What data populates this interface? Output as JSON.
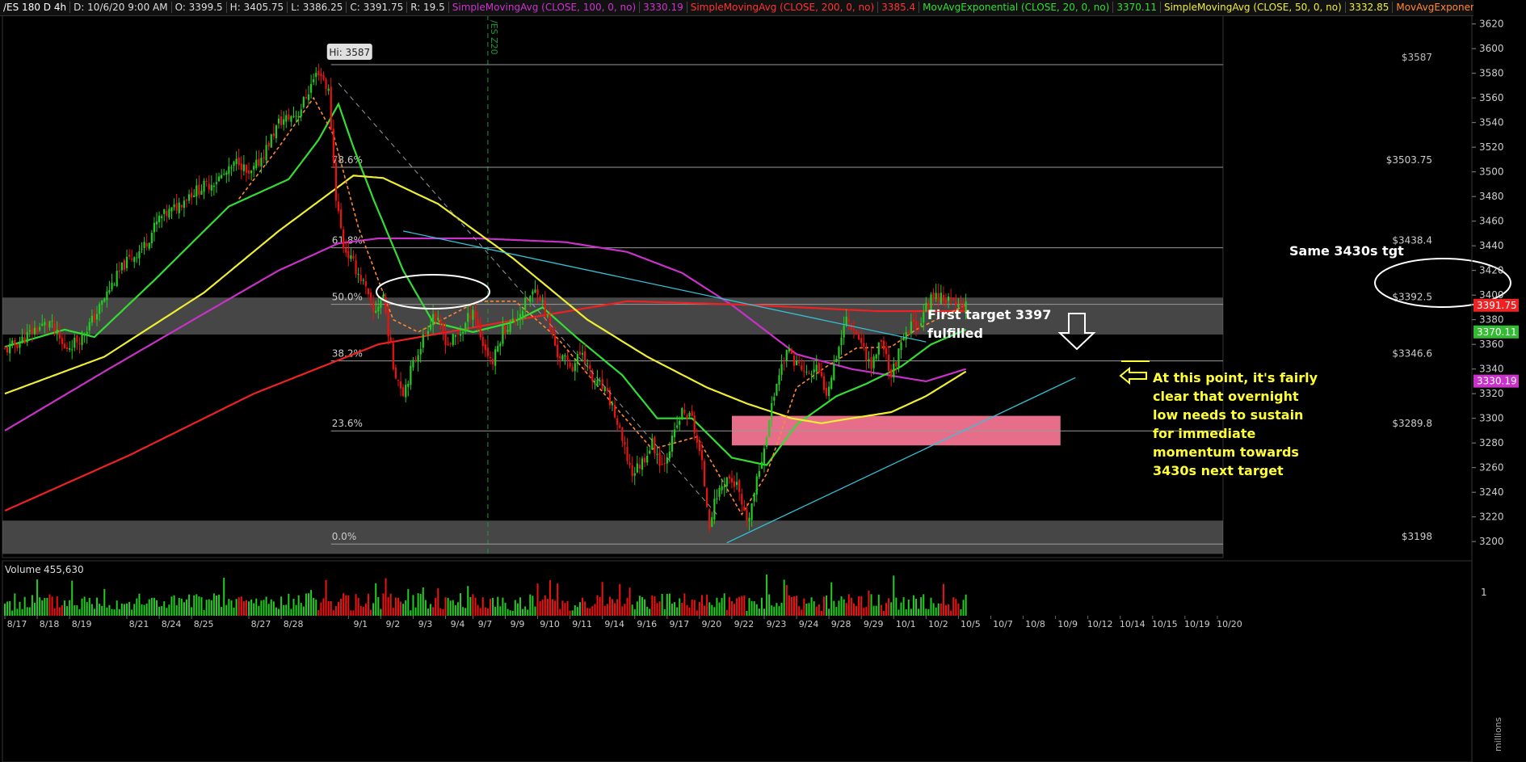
{
  "header": {
    "symbol": "/ES 180 D 4h",
    "items": [
      {
        "text": "D: 10/6/20 9:00 AM",
        "color": "#dddddd"
      },
      {
        "text": "O: 3399.5",
        "color": "#dddddd"
      },
      {
        "text": "H: 3405.75",
        "color": "#dddddd"
      },
      {
        "text": "L: 3386.25",
        "color": "#dddddd"
      },
      {
        "text": "C: 3391.75",
        "color": "#dddddd"
      },
      {
        "text": "R: 19.5",
        "color": "#dddddd"
      },
      {
        "text": "SimpleMovingAvg (CLOSE, 100, 0, no)",
        "color": "#cc33cc"
      },
      {
        "text": "3330.19",
        "color": "#cc33cc"
      },
      {
        "text": "SimpleMovingAvg (CLOSE, 200, 0, no)",
        "color": "#ff3333"
      },
      {
        "text": "3385.4",
        "color": "#ff3333"
      },
      {
        "text": "MovAvgExponential (CLOSE, 20, 0, no)",
        "color": "#33dd33"
      },
      {
        "text": "3370.11",
        "color": "#33dd33"
      },
      {
        "text": "SimpleMovingAvg (CLOSE, 50, 0, no)",
        "color": "#eeee33"
      },
      {
        "text": "3332.85",
        "color": "#eeee33"
      },
      {
        "text": "MovAvgExponential ...",
        "color": "#ff8833"
      }
    ]
  },
  "colors": {
    "up": "#22cc22",
    "down": "#ee1111",
    "sma100": "#c832c8",
    "sma200": "#ee2222",
    "ema20": "#33dd33",
    "sma50": "#eeee33",
    "ema9": "#ff8833",
    "trendline": "#33c3d8",
    "zone": "#808080",
    "pinkzone": "#ff7a9a",
    "annotation_yellow": "#ffff33",
    "annotation_white": "#ffffff"
  },
  "chart_data": {
    "type": "candlestick",
    "ylim": [
      3187,
      3627
    ],
    "yticks": [
      3200,
      3220,
      3240,
      3260,
      3280,
      3300,
      3320,
      3340,
      3360,
      3380,
      3400,
      3420,
      3440,
      3460,
      3480,
      3500,
      3520,
      3540,
      3560,
      3580,
      3600,
      3620
    ],
    "x_dates": [
      "8/17",
      "8/18",
      "8/19",
      "8/21",
      "8/24",
      "8/25",
      "8/27",
      "8/28",
      "9/1",
      "9/2",
      "9/3",
      "9/4",
      "9/7",
      "9/9",
      "9/10",
      "9/11",
      "9/14",
      "9/16",
      "9/17",
      "9/20",
      "9/22",
      "9/23",
      "9/24",
      "9/28",
      "9/29",
      "10/1",
      "10/2",
      "10/5",
      "10/7",
      "10/8",
      "10/9",
      "10/12",
      "10/14",
      "10/15",
      "10/19",
      "10/20"
    ],
    "x_bars": [
      0,
      13,
      26,
      49,
      62,
      75,
      98,
      111,
      138,
      151,
      164,
      177,
      188,
      201,
      214,
      227,
      240,
      253,
      266,
      279,
      292,
      305,
      318,
      331,
      344,
      357,
      370,
      383,
      396,
      409,
      422,
      435,
      448,
      461,
      474,
      487
    ],
    "price_anchors": [
      [
        0,
        3355
      ],
      [
        6,
        3362
      ],
      [
        12,
        3372
      ],
      [
        18,
        3378
      ],
      [
        24,
        3356
      ],
      [
        30,
        3365
      ],
      [
        36,
        3382
      ],
      [
        42,
        3405
      ],
      [
        48,
        3425
      ],
      [
        56,
        3440
      ],
      [
        62,
        3462
      ],
      [
        68,
        3470
      ],
      [
        74,
        3482
      ],
      [
        82,
        3490
      ],
      [
        90,
        3500
      ],
      [
        94,
        3510
      ],
      [
        98,
        3495
      ],
      [
        104,
        3515
      ],
      [
        110,
        3540
      ],
      [
        118,
        3548
      ],
      [
        124,
        3575
      ],
      [
        126,
        3582
      ],
      [
        128,
        3575
      ],
      [
        130,
        3565
      ],
      [
        133,
        3480
      ],
      [
        136,
        3440
      ],
      [
        140,
        3425
      ],
      [
        144,
        3410
      ],
      [
        148,
        3385
      ],
      [
        152,
        3400
      ],
      [
        156,
        3342
      ],
      [
        160,
        3322
      ],
      [
        166,
        3355
      ],
      [
        172,
        3385
      ],
      [
        178,
        3360
      ],
      [
        184,
        3372
      ],
      [
        188,
        3390
      ],
      [
        192,
        3360
      ],
      [
        196,
        3345
      ],
      [
        200,
        3372
      ],
      [
        205,
        3380
      ],
      [
        210,
        3396
      ],
      [
        214,
        3405
      ],
      [
        218,
        3380
      ],
      [
        222,
        3352
      ],
      [
        228,
        3342
      ],
      [
        232,
        3355
      ],
      [
        236,
        3330
      ],
      [
        240,
        3325
      ],
      [
        244,
        3310
      ],
      [
        248,
        3280
      ],
      [
        252,
        3255
      ],
      [
        256,
        3265
      ],
      [
        260,
        3280
      ],
      [
        264,
        3262
      ],
      [
        268,
        3282
      ],
      [
        272,
        3305
      ],
      [
        276,
        3300
      ],
      [
        280,
        3262
      ],
      [
        283,
        3215
      ],
      [
        286,
        3238
      ],
      [
        290,
        3252
      ],
      [
        294,
        3245
      ],
      [
        298,
        3212
      ],
      [
        302,
        3248
      ],
      [
        306,
        3288
      ],
      [
        310,
        3330
      ],
      [
        314,
        3355
      ],
      [
        318,
        3345
      ],
      [
        322,
        3335
      ],
      [
        326,
        3340
      ],
      [
        330,
        3322
      ],
      [
        334,
        3352
      ],
      [
        338,
        3382
      ],
      [
        342,
        3370
      ],
      [
        346,
        3352
      ],
      [
        348,
        3342
      ],
      [
        352,
        3365
      ],
      [
        356,
        3335
      ],
      [
        360,
        3358
      ],
      [
        364,
        3375
      ],
      [
        368,
        3380
      ],
      [
        372,
        3398
      ],
      [
        376,
        3400
      ],
      [
        380,
        3394
      ],
      [
        384,
        3392
      ],
      [
        386,
        3392
      ]
    ],
    "total_bars": 387,
    "series": [
      {
        "name": "SimpleMovingAvg (CLOSE, 100, 0, no)",
        "key": "sma100",
        "anchors": [
          [
            0,
            3290
          ],
          [
            40,
            3338
          ],
          [
            80,
            3385
          ],
          [
            110,
            3420
          ],
          [
            134,
            3442
          ],
          [
            150,
            3446
          ],
          [
            190,
            3446
          ],
          [
            225,
            3443
          ],
          [
            250,
            3435
          ],
          [
            272,
            3418
          ],
          [
            292,
            3392
          ],
          [
            318,
            3352
          ],
          [
            340,
            3340
          ],
          [
            370,
            3330
          ],
          [
            386,
            3340
          ]
        ]
      },
      {
        "name": "SimpleMovingAvg (CLOSE, 200, 0, no)",
        "key": "sma200",
        "anchors": [
          [
            0,
            3225
          ],
          [
            50,
            3270
          ],
          [
            100,
            3320
          ],
          [
            150,
            3360
          ],
          [
            200,
            3378
          ],
          [
            250,
            3395
          ],
          [
            300,
            3392
          ],
          [
            350,
            3387
          ],
          [
            386,
            3387
          ]
        ]
      },
      {
        "name": "MovAvgExponential (CLOSE, 20, 0, no)",
        "key": "ema20",
        "anchors": [
          [
            0,
            3358
          ],
          [
            24,
            3372
          ],
          [
            36,
            3366
          ],
          [
            60,
            3412
          ],
          [
            90,
            3472
          ],
          [
            114,
            3494
          ],
          [
            126,
            3526
          ],
          [
            134,
            3555
          ],
          [
            140,
            3520
          ],
          [
            148,
            3478
          ],
          [
            160,
            3420
          ],
          [
            172,
            3378
          ],
          [
            188,
            3370
          ],
          [
            204,
            3378
          ],
          [
            216,
            3390
          ],
          [
            230,
            3365
          ],
          [
            248,
            3335
          ],
          [
            262,
            3300
          ],
          [
            276,
            3300
          ],
          [
            292,
            3268
          ],
          [
            306,
            3262
          ],
          [
            318,
            3295
          ],
          [
            334,
            3318
          ],
          [
            346,
            3328
          ],
          [
            360,
            3342
          ],
          [
            372,
            3360
          ],
          [
            386,
            3372
          ]
        ]
      },
      {
        "name": "SimpleMovingAvg (CLOSE, 50, 0, no)",
        "key": "sma50",
        "anchors": [
          [
            0,
            3320
          ],
          [
            40,
            3350
          ],
          [
            80,
            3402
          ],
          [
            110,
            3452
          ],
          [
            132,
            3485
          ],
          [
            140,
            3497
          ],
          [
            152,
            3495
          ],
          [
            174,
            3474
          ],
          [
            204,
            3430
          ],
          [
            234,
            3380
          ],
          [
            258,
            3350
          ],
          [
            282,
            3325
          ],
          [
            298,
            3312
          ],
          [
            316,
            3300
          ],
          [
            328,
            3296
          ],
          [
            340,
            3300
          ],
          [
            356,
            3305
          ],
          [
            370,
            3318
          ],
          [
            386,
            3338
          ]
        ]
      },
      {
        "name": "MovAvgExponential",
        "key": "ema9",
        "anchors": [
          [
            94,
            3478
          ],
          [
            110,
            3520
          ],
          [
            124,
            3560
          ],
          [
            132,
            3530
          ],
          [
            142,
            3455
          ],
          [
            156,
            3380
          ],
          [
            166,
            3370
          ],
          [
            190,
            3395
          ],
          [
            205,
            3395
          ],
          [
            222,
            3365
          ],
          [
            244,
            3312
          ],
          [
            260,
            3275
          ],
          [
            278,
            3285
          ],
          [
            296,
            3222
          ],
          [
            306,
            3255
          ],
          [
            318,
            3325
          ],
          [
            330,
            3342
          ],
          [
            342,
            3357
          ],
          [
            356,
            3358
          ],
          [
            366,
            3372
          ],
          [
            386,
            3392
          ]
        ]
      }
    ],
    "gray_zones": [
      [
        3368,
        3398
      ],
      [
        3190,
        3217
      ]
    ],
    "pink_zone": [
      3278,
      3302
    ],
    "pink_zone_bars": [
      292,
      424
    ],
    "fib_levels": [
      {
        "pct": "78.6%",
        "value": 3503.75,
        "label": "$3503.75"
      },
      {
        "pct": "61.8%",
        "value": 3438.4,
        "label": "$3438.4"
      },
      {
        "pct": "50.0%",
        "value": 3392.5,
        "label": "$3392.5"
      },
      {
        "pct": "38.2%",
        "value": 3346.6,
        "label": "$3346.6"
      },
      {
        "pct": "23.6%",
        "value": 3289.8,
        "label": "$3289.8"
      },
      {
        "pct": "0.0%",
        "value": 3198,
        "label": "$3198"
      }
    ],
    "high_level": {
      "value": 3587,
      "label": "$3587",
      "tag": "Hi: 3587"
    },
    "fib_start_bar": 131,
    "vline_bar": 194,
    "vline_label": "/ES Z20",
    "price_tags": [
      {
        "value": 3391.75,
        "text": "3391.75",
        "bg": "#ee2222"
      },
      {
        "value": 3370.11,
        "text": "3370.11",
        "bg": "#33bb33"
      },
      {
        "value": 3330.19,
        "text": "3330.19",
        "bg": "#c832c8"
      }
    ],
    "trendlines": [
      {
        "color": "#33c3d8",
        "pts": [
          [
            160,
            3452
          ],
          [
            370,
            3362
          ]
        ]
      },
      {
        "color": "#33c3d8",
        "pts": [
          [
            290,
            3199
          ],
          [
            430,
            3333
          ]
        ]
      },
      {
        "color": "#999999",
        "dash": true,
        "pts": [
          [
            134,
            3572
          ],
          [
            286,
            3222
          ]
        ]
      }
    ],
    "volume_label": "Volume",
    "volume_value": "455,630",
    "volume_axis": "1",
    "volume_unit": "millions"
  },
  "annotations": {
    "first_target": [
      "First target 3397",
      "fulfilled"
    ],
    "same_target": "Same 3430s tgt",
    "yellow_note": [
      "At this point, it's fairly",
      "clear that overnight",
      "low needs to sustain",
      "for immediate",
      "momentum towards",
      "3430s next target"
    ]
  }
}
